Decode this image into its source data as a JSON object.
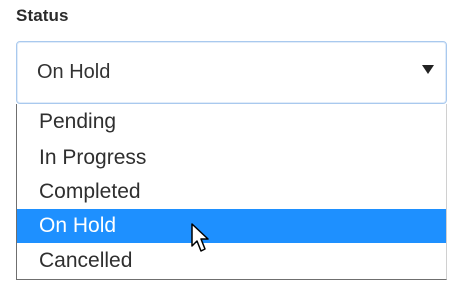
{
  "field": {
    "label": "Status",
    "selected_value": "On Hold"
  },
  "dropdown": {
    "options": [
      {
        "label": "Pending",
        "highlighted": false
      },
      {
        "label": "In Progress",
        "highlighted": false
      },
      {
        "label": "Completed",
        "highlighted": false
      },
      {
        "label": "On Hold",
        "highlighted": true
      },
      {
        "label": "Cancelled",
        "highlighted": false
      }
    ],
    "highlight_color": "#1e90ff"
  },
  "icons": {
    "caret": "chevron-down-icon",
    "cursor": "mouse-pointer-icon"
  }
}
